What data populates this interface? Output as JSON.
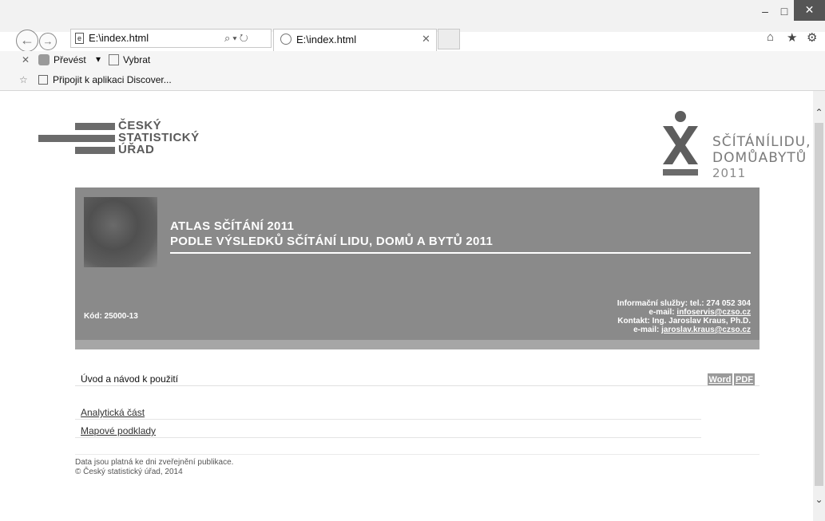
{
  "browser": {
    "address": "E:\\index.html",
    "tab_title": "E:\\index.html",
    "toolbar": {
      "convert_label": "Převést",
      "select_label": "Vybrat"
    },
    "favorites": {
      "item_label": "Připojit k aplikaci Discover..."
    }
  },
  "logo_csu": {
    "line1": "ČESKÝ",
    "line2": "STATISTICKÝ",
    "line3": "ÚŘAD"
  },
  "logo_census": {
    "line1": "SČÍTÁNÍLIDU,",
    "line2": "DOMŮABYTŮ",
    "line3": "2011"
  },
  "banner": {
    "title_line1": "ATLAS SČÍTÁNÍ 2011",
    "title_line2": "PODLE VÝSLEDKŮ SČÍTÁNÍ LIDU, DOMŮ A BYTŮ 2011",
    "code": "Kód: 25000-13",
    "info_services": "Informační služby: tel.: 274 052 304",
    "email_label_1": "e-mail: ",
    "email_1": "infoservis@czso.cz",
    "contact": "Kontakt: Ing. Jaroslav Kraus, Ph.D.",
    "email_label_2": "e-mail: ",
    "email_2": "jaroslav.kraus@czso.cz"
  },
  "content": {
    "intro_label": "Úvod a návod k použití",
    "word_label": "Word",
    "pdf_label": "PDF",
    "links": [
      "Analytická část",
      "Mapové podklady"
    ]
  },
  "footer": {
    "line1": "Data jsou platná ke dni zveřejnění publikace.",
    "line2": "© Český statistický úřad, 2014"
  },
  "colors": {
    "banner": "#8a8a8a",
    "logo_gray": "#6b6b6b"
  }
}
